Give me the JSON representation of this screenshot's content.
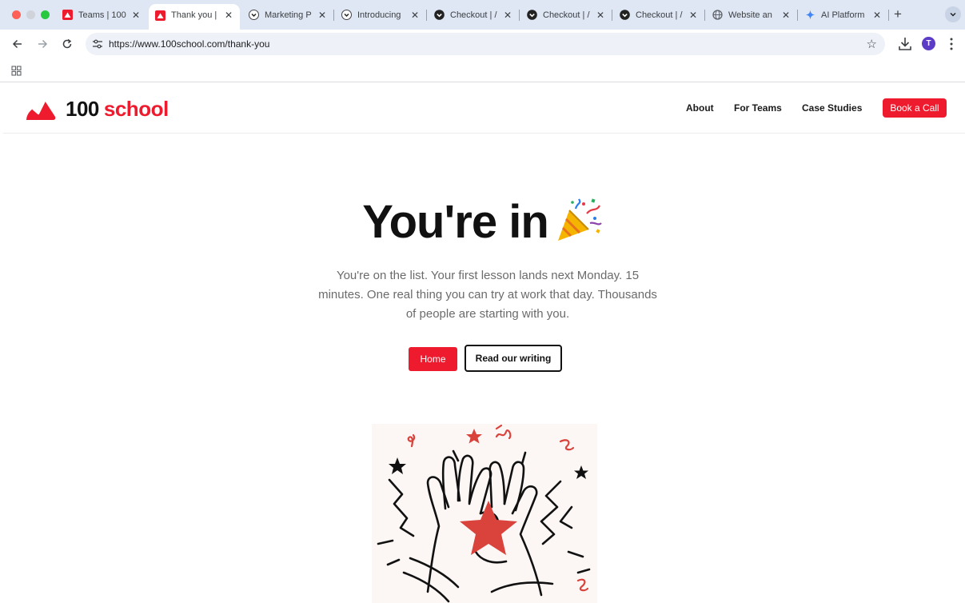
{
  "browser": {
    "tabs": [
      {
        "title": "Teams | 100",
        "icon": "100school-favicon",
        "active": false
      },
      {
        "title": "Thank you |",
        "icon": "100school-favicon",
        "active": true
      },
      {
        "title": "Marketing P",
        "icon": "chevron-circle-favicon",
        "active": false
      },
      {
        "title": "Introducing",
        "icon": "chevron-circle-favicon",
        "active": false
      },
      {
        "title": "Checkout | /",
        "icon": "checkout-favicon",
        "active": false
      },
      {
        "title": "Checkout | /",
        "icon": "checkout-favicon",
        "active": false
      },
      {
        "title": "Checkout | /",
        "icon": "checkout-favicon",
        "active": false
      },
      {
        "title": "Website an",
        "icon": "globe-favicon",
        "active": false
      },
      {
        "title": "AI Platform",
        "icon": "sparkle-favicon",
        "active": false
      }
    ],
    "close_glyph": "✕",
    "new_tab_glyph": "+",
    "url": "https://www.100school.com/thank-you",
    "profile_initial": "T",
    "star_glyph": "☆"
  },
  "site": {
    "logo_number": "100",
    "logo_word": "school",
    "nav": {
      "about": "About",
      "for_teams": "For Teams",
      "case_studies": "Case Studies"
    },
    "cta": "Book a Call",
    "brand_color": "#ee1b2e"
  },
  "hero": {
    "title": "You're in",
    "body": "You're on the list. Your first lesson lands next Monday. 15 minutes. One real thing you can try at work that day. Thousands of people are starting with you.",
    "primary_button": "Home",
    "secondary_button": "Read our writing"
  }
}
